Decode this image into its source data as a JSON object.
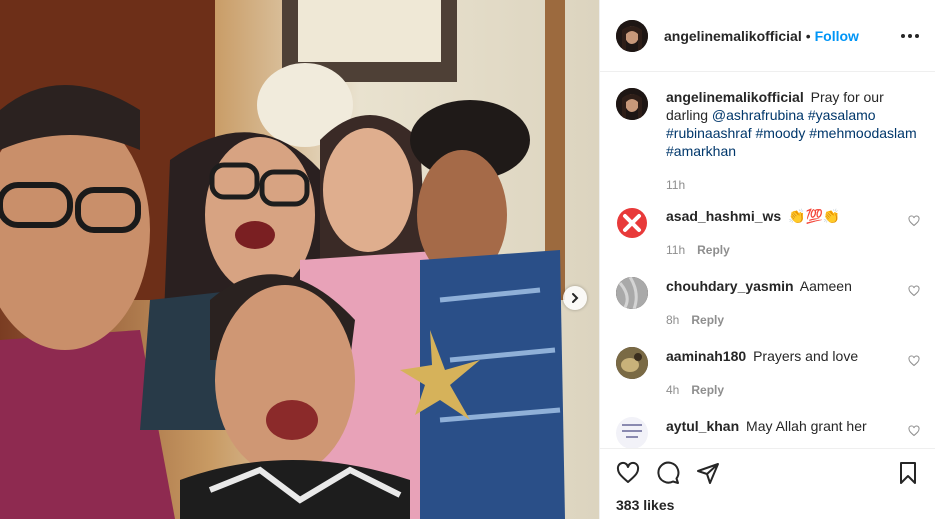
{
  "header": {
    "username": "angelinemalikofficial",
    "separator": "•",
    "follow_label": "Follow",
    "more_icon": "more-horizontal-icon"
  },
  "caption": {
    "username": "angelinemalikofficial",
    "text": "Pray for our darling",
    "tags": [
      "@ashrafrubina",
      "#yasalamo",
      "#rubinaashraf",
      "#moody",
      "#mehmoodaslam",
      "#amarkhan"
    ],
    "time": "11h"
  },
  "comments": [
    {
      "username": "asad_hashmi_ws",
      "text": "👏💯👏",
      "time": "11h",
      "reply_label": "Reply"
    },
    {
      "username": "chouhdary_yasmin",
      "text": "Aameen",
      "time": "8h",
      "reply_label": "Reply"
    },
    {
      "username": "aaminah180",
      "text": "Prayers and love",
      "time": "4h",
      "reply_label": "Reply"
    },
    {
      "username": "aytul_khan",
      "text": "May Allah grant her",
      "time": "",
      "reply_label": ""
    }
  ],
  "actions": {
    "like_icon": "heart-icon",
    "comment_icon": "comment-icon",
    "share_icon": "paper-plane-icon",
    "save_icon": "bookmark-icon",
    "likes": "383 likes"
  },
  "colors": {
    "link": "#00376b",
    "follow": "#0095f6",
    "muted": "#8e8e8e",
    "text": "#262626"
  }
}
